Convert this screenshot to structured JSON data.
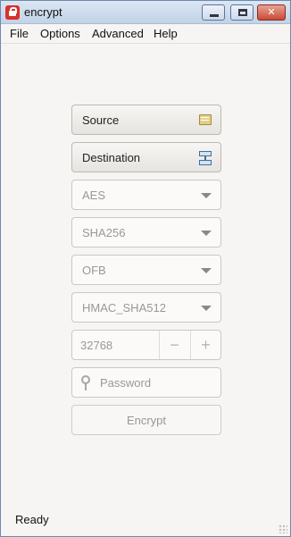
{
  "window": {
    "title": "encrypt"
  },
  "titlebar_buttons": {
    "minimize": "",
    "maximize": "",
    "close": "✕"
  },
  "menu": [
    "File",
    "Options",
    "Advanced",
    "Help"
  ],
  "form": {
    "source_label": "Source",
    "destination_label": "Destination",
    "cipher": {
      "selected": "AES"
    },
    "hash": {
      "selected": "SHA256"
    },
    "mode": {
      "selected": "OFB"
    },
    "mac": {
      "selected": "HMAC_SHA512"
    },
    "kdf_iterations": {
      "value": "32768",
      "decrement": "−",
      "increment": "+"
    },
    "password": {
      "placeholder": "Password"
    },
    "encrypt_label": "Encrypt"
  },
  "status": {
    "text": "Ready"
  },
  "icons": {
    "app": "padlock-icon",
    "source": "folder-icon",
    "destination": "save-destination-icon",
    "password": "key-icon",
    "select": "chevron-down-icon"
  }
}
